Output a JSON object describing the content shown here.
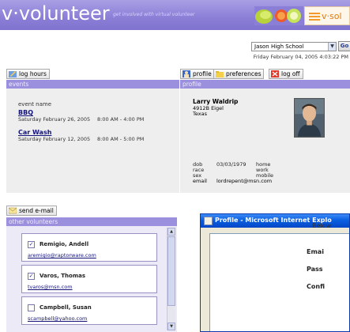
{
  "banner": {
    "brand": "v·volunteer",
    "tagline": "get involved with virtual volunteer",
    "logo2_text": "v·sol"
  },
  "school": {
    "selected": "Jason High School",
    "go_label": "Go"
  },
  "datetime": "Friday February 04, 2005    4:03:22 PM",
  "toolbar": {
    "log_hours": "log hours",
    "profile": "profile",
    "preferences": "preferences",
    "log_off": "log off",
    "send_email": "send e-mail"
  },
  "events": {
    "header": "events",
    "column": "event name",
    "items": [
      {
        "name": "BBQ",
        "date": "Saturday February 26, 2005",
        "time": "8:00 AM - 4:00 PM"
      },
      {
        "name": "Car Wash",
        "date": "Saturday February 12, 2005",
        "time": "8:00 AM - 5:00 PM"
      }
    ]
  },
  "profile": {
    "header": "profile",
    "name": "Larry Waldrip",
    "address1": "4912B Eigel",
    "address2": "Texas",
    "fields": [
      {
        "label": "dob",
        "value": "03/03/1979",
        "right": "home"
      },
      {
        "label": "race",
        "value": "",
        "right": "work"
      },
      {
        "label": "sex",
        "value": "",
        "right": "mobile"
      }
    ],
    "email_label": "email",
    "email": "lordrepent@msn.com"
  },
  "volunteers": {
    "header": "other volunteers",
    "items": [
      {
        "name": "Remigio, Andell",
        "email": "aremigio@raptorware.com",
        "checked": true,
        "mark": "✓"
      },
      {
        "name": "Varos, Thomas",
        "email": "tvaros@msn.com",
        "checked": true,
        "mark": "✓"
      },
      {
        "name": "Campbell, Susan",
        "email": "scampbell@yahoo.com",
        "checked": false,
        "mark": ""
      }
    ]
  },
  "popup": {
    "title": "Profile - Microsoft Internet Explo",
    "below": "Below",
    "email_label": "Emai",
    "password_label": "Pass",
    "confirm_label": "Confi"
  },
  "colors": {
    "banner": "#8a7ed6",
    "section_bar": "#9b90dd",
    "panel": "#eeeeee",
    "link": "#13137a",
    "xp_title": "#0a5fe0"
  }
}
